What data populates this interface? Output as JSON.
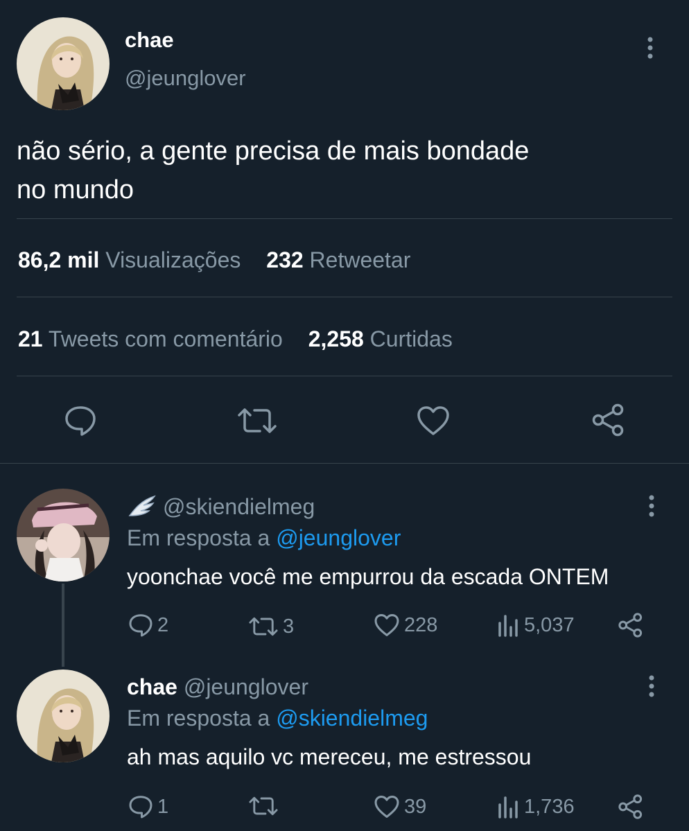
{
  "main_tweet": {
    "display_name": "chae",
    "handle": "@jeunglover",
    "text_line1": "não sério, a gente precisa de mais bondade",
    "text_line2": "no mundo",
    "stats": {
      "views_count": "86,2 mil",
      "views_label": "Visualizações",
      "retweets_count": "232",
      "retweets_label": "Retweetar",
      "quotes_count": "21",
      "quotes_label": "Tweets com comentário",
      "likes_count": "2,258",
      "likes_label": "Curtidas"
    },
    "actions": [
      "reply-icon",
      "retweet-icon",
      "like-icon",
      "share-icon"
    ]
  },
  "replies": [
    {
      "display_name_icon": "wing-icon",
      "handle": "@skiendielmeg",
      "reply_prefix": "Em resposta a",
      "reply_to": "@jeunglover",
      "text": "yoonchae você me empurrou da escada ONTEM",
      "replies": "2",
      "retweets": "3",
      "likes": "228",
      "views": "5,037"
    },
    {
      "display_name": "chae",
      "handle": "@jeunglover",
      "reply_prefix": "Em resposta a",
      "reply_to": "@skiendielmeg",
      "text": "ah mas aquilo vc mereceu, me estressou",
      "replies": "1",
      "retweets": "",
      "likes": "39",
      "views": "1,736"
    }
  ],
  "colors": {
    "background": "#15202b",
    "divider": "#38444d",
    "muted_text": "#8899a6",
    "link": "#1d9bf0",
    "text": "#ffffff"
  }
}
